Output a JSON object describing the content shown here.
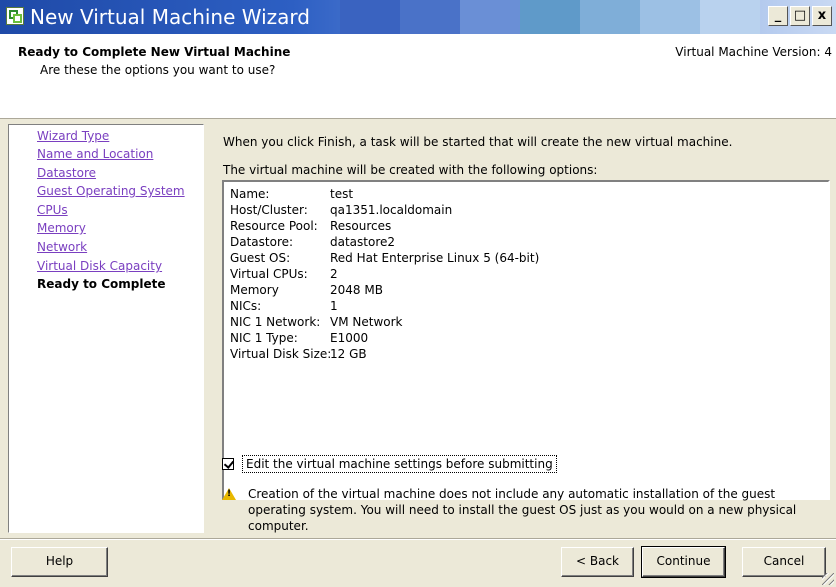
{
  "window": {
    "title": "New Virtual Machine Wizard",
    "controls": {
      "minimize": "_",
      "maximize": "□",
      "close": "x"
    }
  },
  "header": {
    "title": "Ready to Complete New Virtual Machine",
    "subtitle": "Are these the options you want to use?",
    "version": "Virtual Machine Version: 4"
  },
  "nav": {
    "items": [
      {
        "label": "Wizard Type"
      },
      {
        "label": "Name and Location"
      },
      {
        "label": "Datastore"
      },
      {
        "label": "Guest Operating System"
      },
      {
        "label": "CPUs"
      },
      {
        "label": "Memory"
      },
      {
        "label": "Network"
      },
      {
        "label": "Virtual Disk Capacity"
      },
      {
        "label": "Ready to Complete"
      }
    ],
    "current": "Ready to Complete"
  },
  "main": {
    "intro": "When you click Finish, a task will be started that will create the new virtual machine.",
    "options_label": "The virtual machine will be created with the following options:",
    "options": [
      {
        "label": "Name:",
        "value": "test"
      },
      {
        "label": "Host/Cluster:",
        "value": "qa1351.localdomain"
      },
      {
        "label": "Resource Pool:",
        "value": "Resources"
      },
      {
        "label": "Datastore:",
        "value": "datastore2"
      },
      {
        "label": "Guest OS:",
        "value": "Red Hat Enterprise Linux 5 (64-bit)"
      },
      {
        "label": "Virtual CPUs:",
        "value": "2"
      },
      {
        "label": "Memory",
        "value": "2048 MB"
      },
      {
        "label": "NICs:",
        "value": "1"
      },
      {
        "label": "NIC 1 Network:",
        "value": "VM Network"
      },
      {
        "label": "NIC 1 Type:",
        "value": "E1000"
      },
      {
        "label": "Virtual Disk Size:",
        "value": "12 GB"
      }
    ],
    "edit_checkbox": {
      "label": "Edit the virtual machine settings before submitting",
      "checked": true
    },
    "warning": "Creation of the virtual machine does not include any automatic installation of the guest operating system. You will need to install the guest OS just as you would on a new physical computer."
  },
  "buttons": {
    "help": "Help",
    "back": "< Back",
    "continue": "Continue",
    "cancel": "Cancel"
  },
  "icons": {
    "app": "vm-wizard-icon",
    "warning": "warning-icon",
    "checkbox": "check-icon"
  },
  "colors": {
    "titlebar_start": "#1f4aa8",
    "titlebar_end": "#c9d9f3",
    "link": "#7a3fc0",
    "dialog_bg": "#ece9d8",
    "warning": "#e8b800"
  }
}
